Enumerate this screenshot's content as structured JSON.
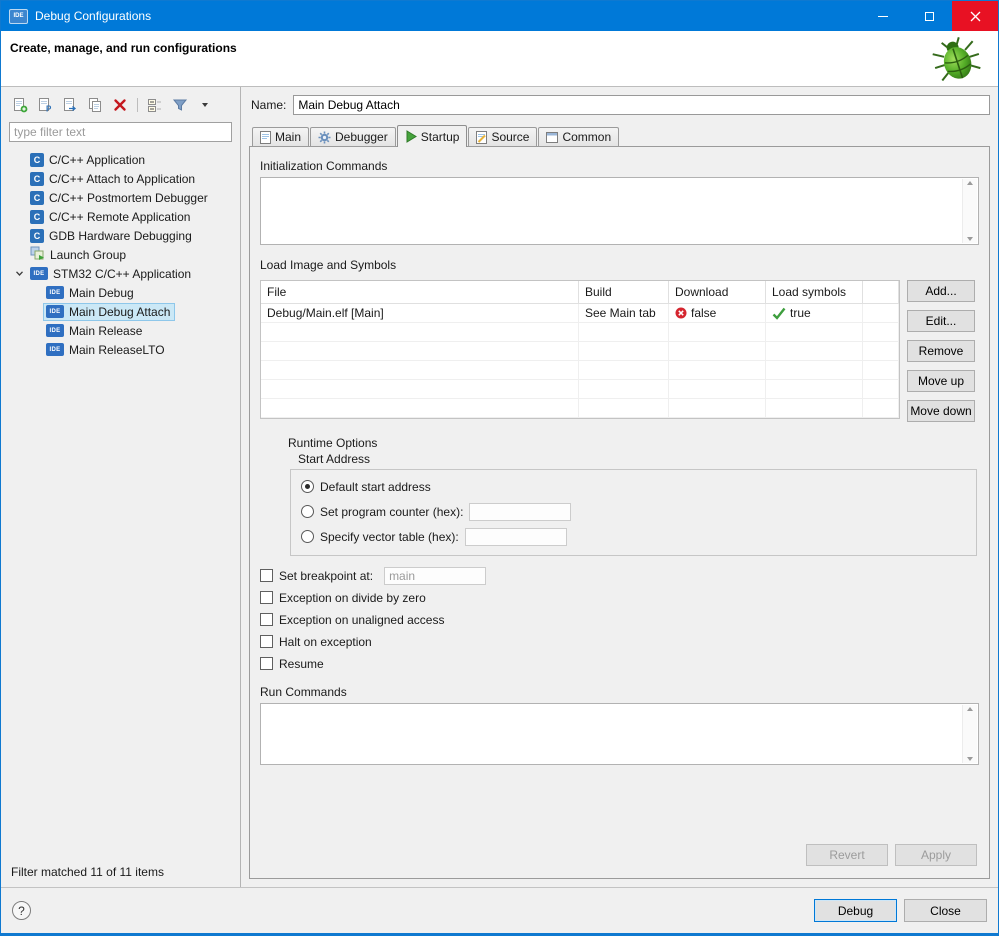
{
  "window": {
    "title": "Debug Configurations"
  },
  "icons": {
    "ide_badge": "IDE",
    "c_badge": "C"
  },
  "header": {
    "title": "Create, manage, and run configurations"
  },
  "sidebar": {
    "filter_placeholder": "type filter text",
    "tree": [
      {
        "label": "C/C++ Application"
      },
      {
        "label": "C/C++ Attach to Application"
      },
      {
        "label": "C/C++ Postmortem Debugger"
      },
      {
        "label": "C/C++ Remote Application"
      },
      {
        "label": "GDB Hardware Debugging"
      },
      {
        "label": "Launch Group"
      },
      {
        "label": "STM32 C/C++ Application"
      },
      {
        "label": "Main Debug"
      },
      {
        "label": "Main Debug Attach"
      },
      {
        "label": "Main Release"
      },
      {
        "label": "Main ReleaseLTO"
      }
    ],
    "status": "Filter matched 11 of 11 items"
  },
  "form": {
    "name_label": "Name:",
    "name_value": "Main Debug Attach",
    "tabs": [
      "Main",
      "Debugger",
      "Startup",
      "Source",
      "Common"
    ],
    "init_commands_title": "Initialization Commands",
    "load": {
      "title": "Load Image and Symbols",
      "columns": [
        "File",
        "Build",
        "Download",
        "Load symbols"
      ],
      "row": {
        "file": "Debug/Main.elf [Main]",
        "build": "See Main tab",
        "download": "false",
        "load_symbols": "true"
      },
      "buttons": {
        "add": "Add...",
        "edit": "Edit...",
        "remove": "Remove",
        "move_up": "Move up",
        "move_down": "Move down"
      }
    },
    "runtime": {
      "title": "Runtime Options",
      "start_address_title": "Start Address",
      "radio_default": "Default start address",
      "radio_pc": "Set program counter (hex):",
      "radio_vector": "Specify vector table (hex):",
      "cb_breakpoint": "Set breakpoint at:",
      "breakpoint_value": "main",
      "cb_divide": "Exception on divide by zero",
      "cb_unaligned": "Exception on unaligned access",
      "cb_halt": "Halt on exception",
      "cb_resume": "Resume"
    },
    "run_commands_title": "Run Commands",
    "revert": "Revert",
    "apply": "Apply"
  },
  "footer": {
    "help": "?",
    "debug": "Debug",
    "close": "Close"
  }
}
